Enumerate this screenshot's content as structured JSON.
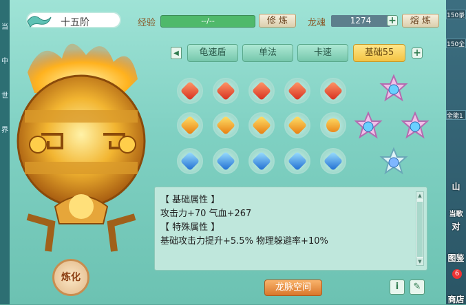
{
  "header": {
    "rank_label": "十五阶",
    "exp_label": "经验",
    "exp_value": "--/--",
    "train_button": "修 炼",
    "soul_label": "龙魂",
    "soul_value": "1274",
    "smelt_button": "熔 炼"
  },
  "tabs": [
    "龟速盾",
    "单法",
    "卡速",
    "基础55"
  ],
  "active_tab": "基础55",
  "gems": {
    "row1": [
      "red",
      "red",
      "red",
      "red",
      "red"
    ],
    "row2": [
      "orange",
      "orange",
      "orange",
      "orange",
      "orange"
    ],
    "row3": [
      "blue",
      "blue",
      "blue",
      "blue",
      "blue"
    ]
  },
  "attributes": {
    "base_title": "【 基础属性 】",
    "base_values": "攻击力+70  气血+267",
    "special_title": "【 特殊属性 】",
    "special_values": "基础攻击力提升+5.5%  物理躲避率+10%"
  },
  "buttons": {
    "refine": "炼化",
    "space": "龙脉空间",
    "info": "i"
  },
  "right_strip": {
    "items": [
      "150录",
      "150全",
      "全能1",
      "山",
      "当歌",
      "对"
    ],
    "guide": "图鉴",
    "shop": "商店",
    "shop_badge": "6"
  },
  "left_strip": [
    "当",
    "中",
    "世",
    "界"
  ]
}
